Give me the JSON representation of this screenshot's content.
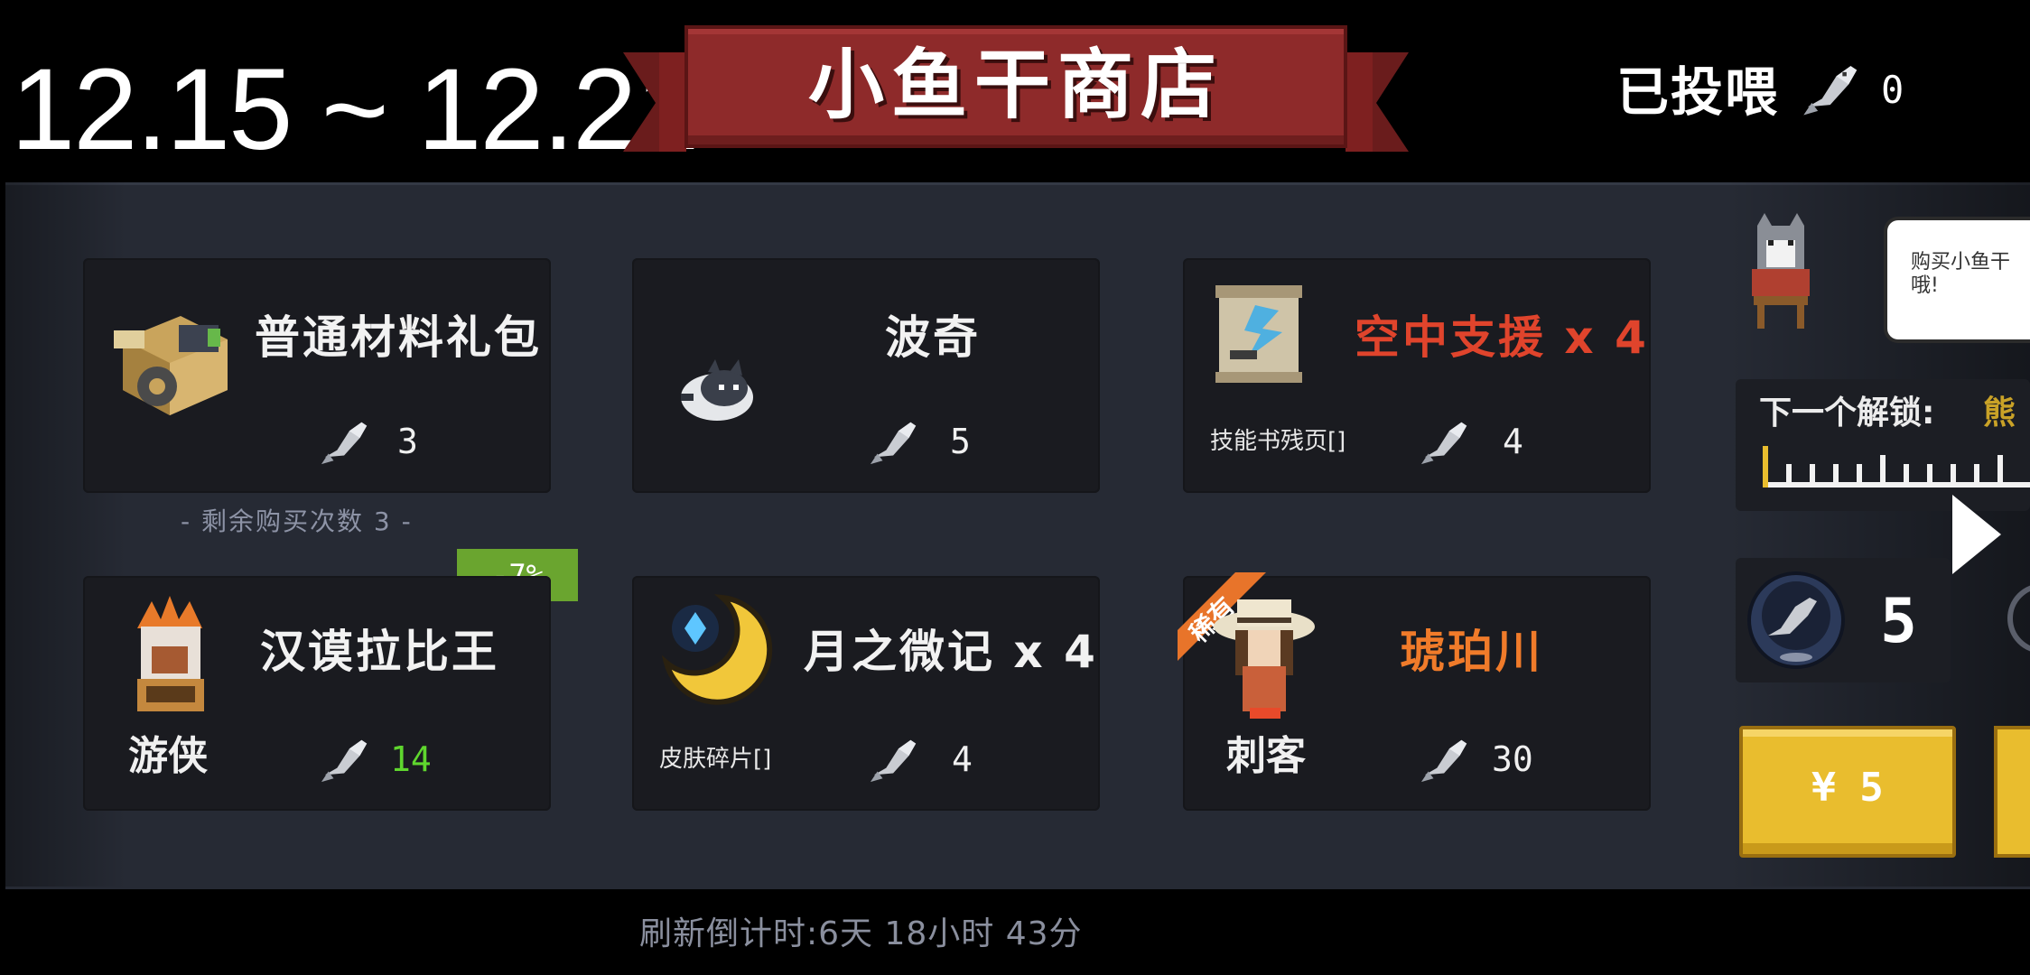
{
  "header": {
    "date_range": "12.15 ~ 12.21",
    "title": "小鱼干商店",
    "fed_label": "已投喂",
    "fed_count": "0"
  },
  "shop": {
    "items": [
      {
        "name": "普通材料礼包",
        "price": "3",
        "icon": "material-pack-icon"
      },
      {
        "name": "波奇",
        "price": "5",
        "icon": "cat-pet-icon"
      },
      {
        "name": "空中支援 x 4",
        "sub": "技能书残页[]",
        "price": "4",
        "icon": "skill-scroll-icon",
        "name_color": "#e0442c"
      },
      {
        "name": "汉谟拉比王",
        "class": "游侠",
        "price": "14",
        "icon": "king-skin-icon",
        "price_color": "#5fd62e",
        "discount": "-7%"
      },
      {
        "name": "月之微记 x 4",
        "sub": "皮肤碎片[]",
        "price": "4",
        "icon": "moon-emblem-icon"
      },
      {
        "name": "琥珀川",
        "class": "刺客",
        "price": "30",
        "icon": "assassin-skin-icon",
        "name_color": "#f07b2a",
        "tag": "稀有"
      }
    ],
    "remaining_purchases": "- 剩余购买次数 3 -",
    "refresh_countdown": "刷新倒计时:6天 18小时 43分"
  },
  "side": {
    "bubble_text": "购买小鱼干哦!",
    "unlock_label": "下一个解锁:",
    "unlock_target": "熊",
    "bowl_count": "5",
    "buy_button": "¥ 5"
  },
  "colors": {
    "panel": "#262a34",
    "card": "#1a1b20",
    "banner": "#8e2a2a",
    "banner_dark": "#6a1c1c",
    "accent_gold": "#e9bd2e",
    "discount_green": "#6aa52f"
  }
}
